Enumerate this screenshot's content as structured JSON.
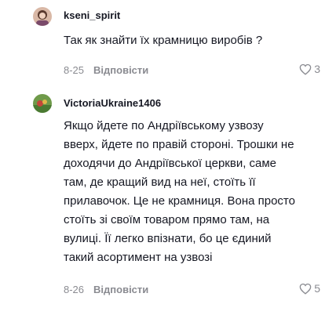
{
  "comments": [
    {
      "username": "kseni_spirit",
      "text": "Так як знайти їх крамницю виробів ?",
      "date": "8-25",
      "reply_label": "Відповісти",
      "likes": "3",
      "avatar_icon": "user-avatar-photo"
    },
    {
      "username": "VictoriaUkraine1406",
      "text": "Якщо йдете по Андріївському узвозу\nвверх, йдете по правій стороні. Трошки не\nдоходячи до Андріївської церкви, саме\nтам, де кращий вид на неї, стоїть її\nприлавочок. Це не крамниця. Вона просто\nстоїть зі своїм товаром прямо там, на\nвулиці. Її легко впізнати, бо це єдиний\nтакий асортимент на узвозі",
      "date": "8-26",
      "reply_label": "Відповісти",
      "likes": "5",
      "avatar_icon": "user-avatar-photo"
    }
  ],
  "colors": {
    "text": "#161823",
    "muted": "#8a8b91",
    "background": "#ffffff"
  }
}
